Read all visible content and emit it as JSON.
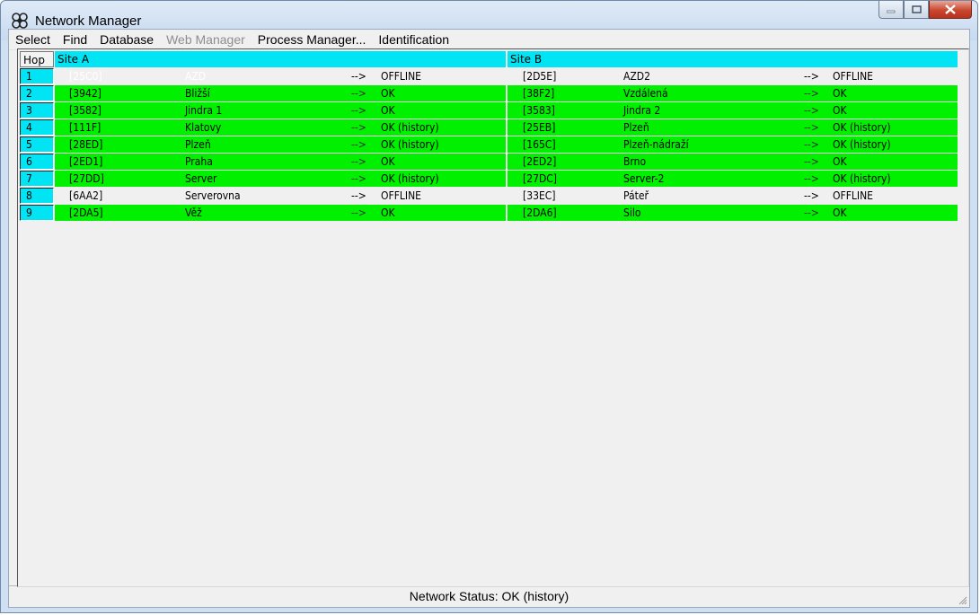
{
  "window": {
    "title": "Network Manager",
    "icon": "network-icon"
  },
  "menu": [
    {
      "label": "Select",
      "enabled": true
    },
    {
      "label": "Find",
      "enabled": true
    },
    {
      "label": "Database",
      "enabled": true
    },
    {
      "label": "Web Manager",
      "enabled": false
    },
    {
      "label": "Process Manager...",
      "enabled": true
    },
    {
      "label": "Identification",
      "enabled": true
    }
  ],
  "grid": {
    "columns": {
      "hop": "Hop",
      "site_a": "Site A",
      "site_b": "Site B"
    },
    "colors": {
      "header": "#00e4f4",
      "ok": "#00f000",
      "offline": "#f0f0f0"
    },
    "rows": [
      {
        "hop": "1",
        "a": {
          "code": "[25C0]",
          "name": "AZD",
          "arrow": "-->",
          "status": "OFFLINE",
          "state": "offline",
          "dim": true
        },
        "b": {
          "code": "[2D5E]",
          "name": "AZD2",
          "arrow": "-->",
          "status": "OFFLINE",
          "state": "offline"
        }
      },
      {
        "hop": "2",
        "a": {
          "code": "[3942]",
          "name": "Bližší",
          "arrow": "-->",
          "status": "OK",
          "state": "ok"
        },
        "b": {
          "code": "[38F2]",
          "name": "Vzdálená",
          "arrow": "-->",
          "status": "OK",
          "state": "ok"
        }
      },
      {
        "hop": "3",
        "a": {
          "code": "[3582]",
          "name": "Jindra 1",
          "arrow": "-->",
          "status": "OK",
          "state": "ok"
        },
        "b": {
          "code": "[3583]",
          "name": "Jindra 2",
          "arrow": "-->",
          "status": "OK",
          "state": "ok"
        }
      },
      {
        "hop": "4",
        "a": {
          "code": "[111F]",
          "name": "Klatovy",
          "arrow": "-->",
          "status": "OK (history)",
          "state": "ok"
        },
        "b": {
          "code": "[25EB]",
          "name": "Plzeň",
          "arrow": "-->",
          "status": "OK (history)",
          "state": "ok"
        }
      },
      {
        "hop": "5",
        "a": {
          "code": "[28ED]",
          "name": "Plzeň",
          "arrow": "-->",
          "status": "OK (history)",
          "state": "ok"
        },
        "b": {
          "code": "[165C]",
          "name": "Plzeň-nádraží",
          "arrow": "-->",
          "status": "OK (history)",
          "state": "ok"
        }
      },
      {
        "hop": "6",
        "a": {
          "code": "[2ED1]",
          "name": "Praha",
          "arrow": "-->",
          "status": "OK",
          "state": "ok"
        },
        "b": {
          "code": "[2ED2]",
          "name": "Brno",
          "arrow": "-->",
          "status": "OK",
          "state": "ok"
        }
      },
      {
        "hop": "7",
        "a": {
          "code": "[27DD]",
          "name": "Server",
          "arrow": "-->",
          "status": "OK (history)",
          "state": "ok"
        },
        "b": {
          "code": "[27DC]",
          "name": "Server-2",
          "arrow": "-->",
          "status": "OK (history)",
          "state": "ok"
        }
      },
      {
        "hop": "8",
        "a": {
          "code": "[6AA2]",
          "name": "Serverovna",
          "arrow": "-->",
          "status": "OFFLINE",
          "state": "offline"
        },
        "b": {
          "code": "[33EC]",
          "name": "Páteř",
          "arrow": "-->",
          "status": "OFFLINE",
          "state": "offline"
        }
      },
      {
        "hop": "9",
        "a": {
          "code": "[2DA5]",
          "name": "Věž",
          "arrow": "-->",
          "status": "OK",
          "state": "ok"
        },
        "b": {
          "code": "[2DA6]",
          "name": "Silo",
          "arrow": "-->",
          "status": "OK",
          "state": "ok"
        }
      }
    ]
  },
  "status": {
    "text": "Network Status: OK (history)"
  }
}
